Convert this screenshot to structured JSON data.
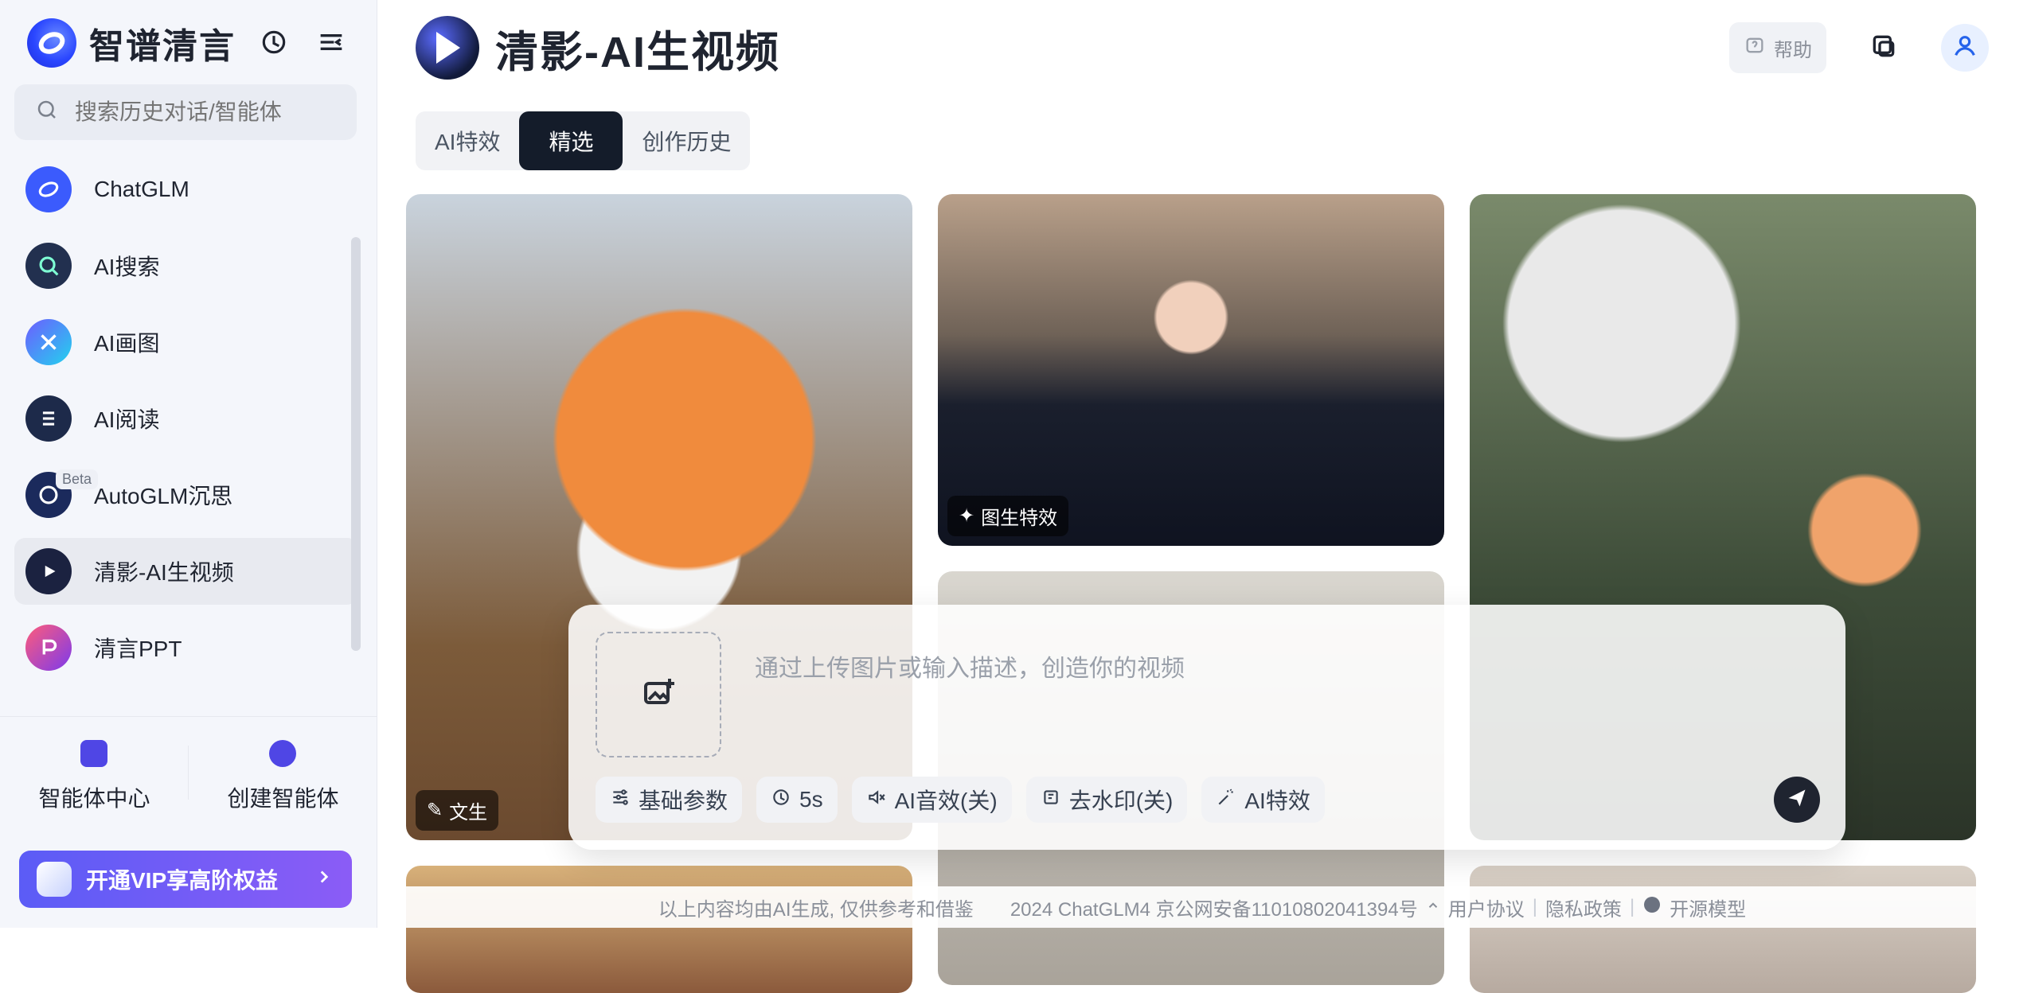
{
  "brand": {
    "name": "智谱清言",
    "icons": [
      "history-icon",
      "collapse-sidebar-icon"
    ]
  },
  "search": {
    "placeholder": "搜索历史对话/智能体"
  },
  "sidebar": {
    "items": [
      {
        "label": "ChatGLM",
        "icon": "chatglm-icon",
        "color": "#3b5bfd"
      },
      {
        "label": "AI搜索",
        "icon": "ai-search-icon",
        "color": "#22304f"
      },
      {
        "label": "AI画图",
        "icon": "ai-draw-icon",
        "color": "#5b4df6"
      },
      {
        "label": "AI阅读",
        "icon": "ai-read-icon",
        "color": "#1d2a4a"
      },
      {
        "label": "AutoGLM沉思",
        "icon": "autoglm-icon",
        "color": "#1b2a5c",
        "badge": "Beta"
      },
      {
        "label": "清影-AI生视频",
        "icon": "qingying-icon",
        "color": "#1b2240",
        "active": true
      },
      {
        "label": "清言PPT",
        "icon": "ppt-icon",
        "color": "#2a1b4a"
      }
    ],
    "bottom_actions": [
      {
        "label": "智能体中心",
        "icon": "agent-center-icon"
      },
      {
        "label": "创建智能体",
        "icon": "create-agent-icon"
      }
    ],
    "vip_label": "开通VIP享高阶权益"
  },
  "header": {
    "title": "清影-AI生视频",
    "help_label": "帮助"
  },
  "tabs": [
    {
      "label": "AI特效"
    },
    {
      "label": "精选",
      "active": true
    },
    {
      "label": "创作历史"
    }
  ],
  "gallery": {
    "items": [
      {
        "label": "文生",
        "icon": "text-to-video-icon"
      },
      {
        "label": "图生特效",
        "icon": "magic-wand-icon"
      }
    ]
  },
  "composer": {
    "placeholder": "通过上传图片或输入描述，创造你的视频",
    "chips": [
      {
        "label": "基础参数",
        "icon": "sliders-icon"
      },
      {
        "label": "5s",
        "icon": "clock-icon"
      },
      {
        "label": "AI音效(关)",
        "icon": "sound-off-icon"
      },
      {
        "label": "去水印(关)",
        "icon": "watermark-icon"
      },
      {
        "label": "AI特效",
        "icon": "magic-wand-icon"
      }
    ]
  },
  "footer": {
    "disclaimer": "以上内容均由AI生成, 仅供参考和借鉴",
    "copyright": "2024 ChatGLM4 京公网安备11010802041394号",
    "links": [
      "用户协议",
      "隐私政策",
      "开源模型"
    ]
  },
  "colors": {
    "accent": "#4f46e5",
    "dark": "#141c2a"
  }
}
